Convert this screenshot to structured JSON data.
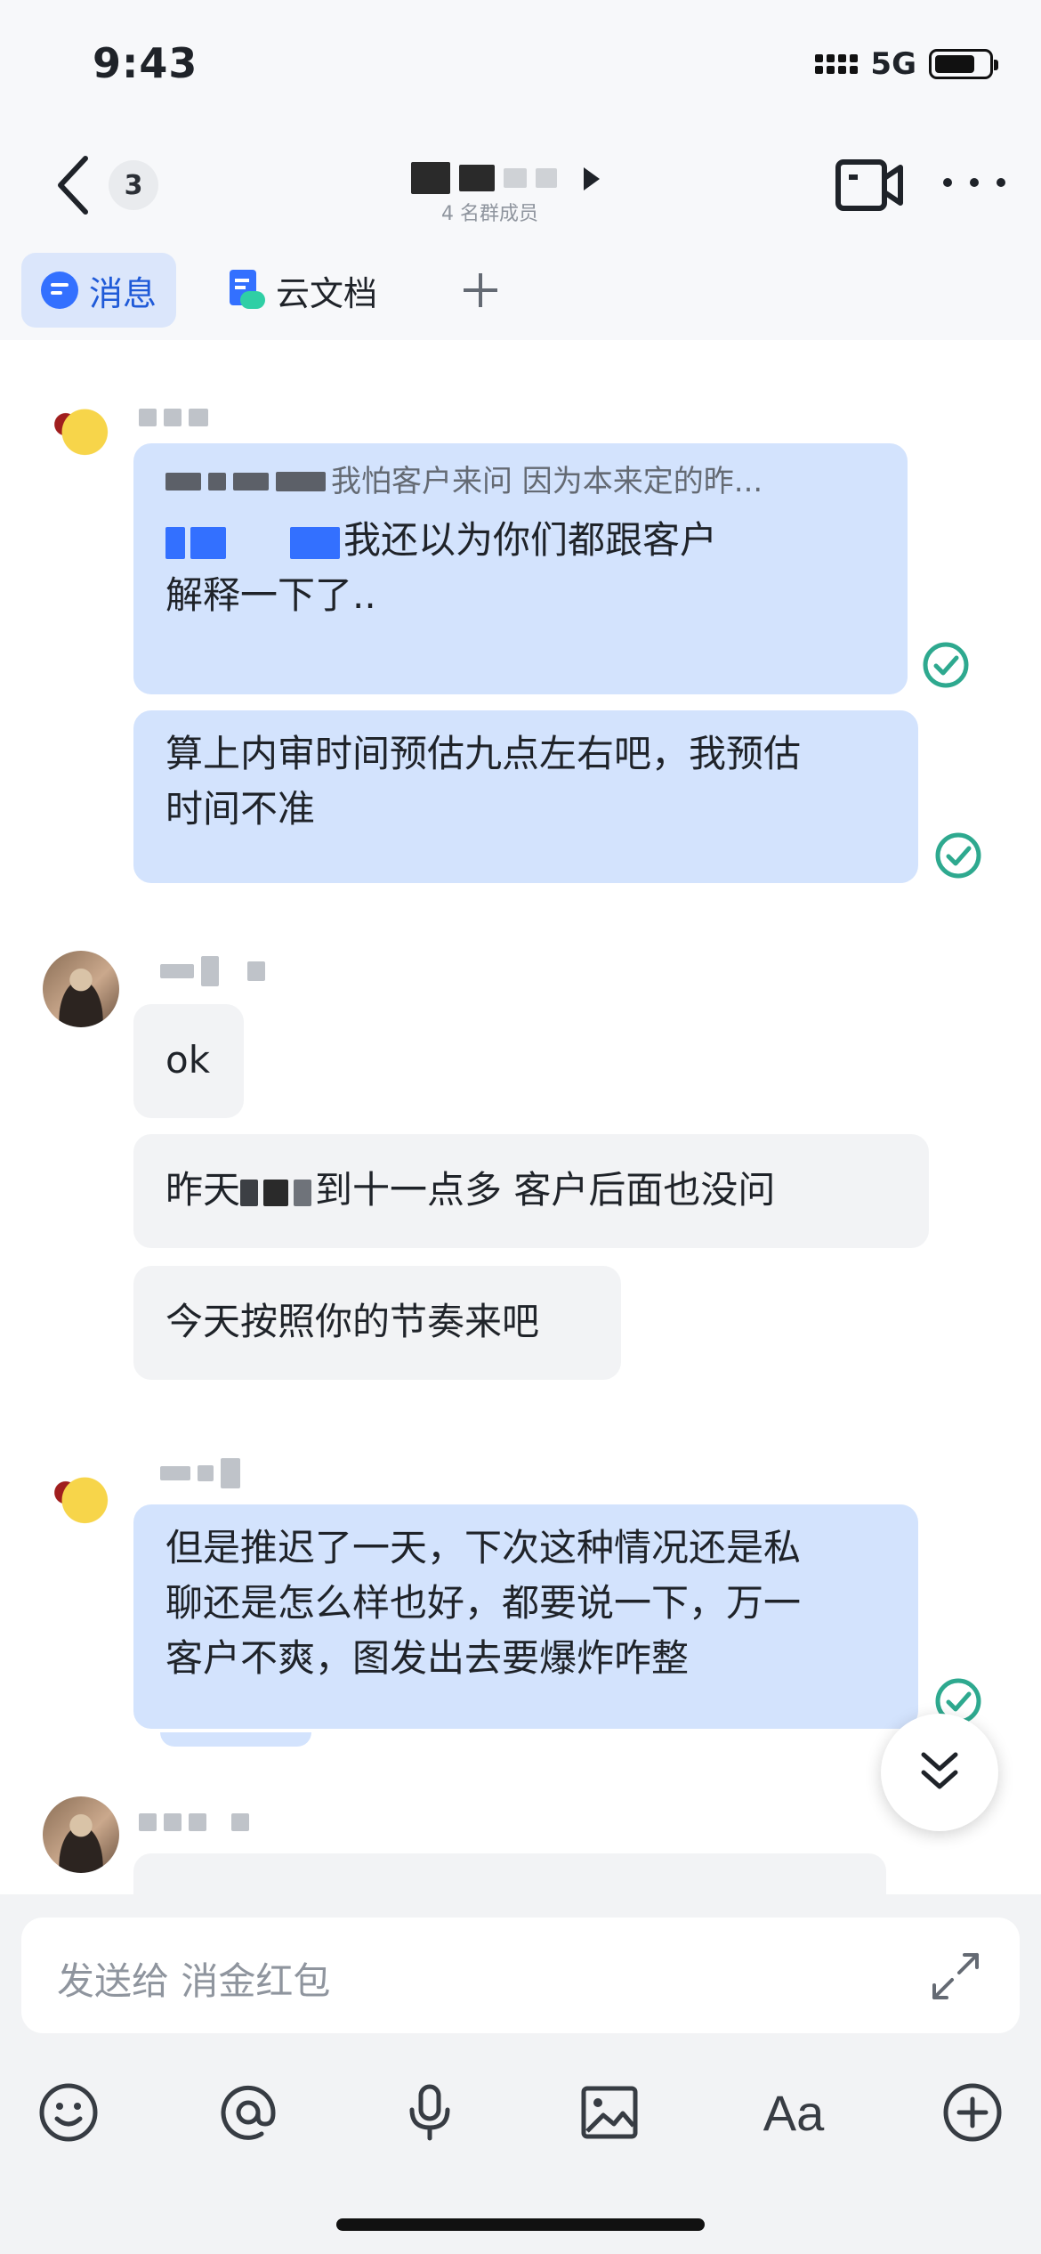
{
  "status_bar": {
    "time": "9:43",
    "network": "5G",
    "battery_level": 0.75
  },
  "nav": {
    "unread_count": "3",
    "member_count": "4 名群成员"
  },
  "tabs": [
    {
      "label": "消息",
      "icon": "message-icon",
      "active": true
    },
    {
      "label": "云文档",
      "icon": "cloud-doc-icon",
      "active": false
    },
    {
      "label": "",
      "icon": "plus-icon",
      "active": false
    }
  ],
  "messages": [
    {
      "quote": "我怕客户来问 因为本来定的昨...",
      "line1": "我还以为你们都跟客户",
      "line2": "解释一下了.."
    },
    {
      "line1": "算上内审时间预估九点左右吧，我预估",
      "line2": "时间不准"
    },
    {
      "text": "ok"
    },
    {
      "prefix": "昨天",
      "suffix": "到十一点多 客户后面也没问"
    },
    {
      "text": "今天按照你的节奏来吧"
    },
    {
      "line1": "但是推迟了一天，下次这种情况还是私",
      "line2": "聊还是怎么样也好，都要说一下，万一",
      "line3": "客户不爽，图发出去要爆炸咋整"
    }
  ],
  "composer": {
    "placeholder": "发送给 消金红包",
    "tools": [
      "emoji-icon",
      "mention-icon",
      "microphone-icon",
      "image-icon",
      "text-format-icon",
      "plus-circle-icon"
    ],
    "text_format_label": "Aa"
  },
  "colors": {
    "accent": "#3370ff",
    "own_bubble": "#d3e3fd",
    "other_bubble": "#f2f3f5",
    "read_check": "#2ea98f"
  }
}
